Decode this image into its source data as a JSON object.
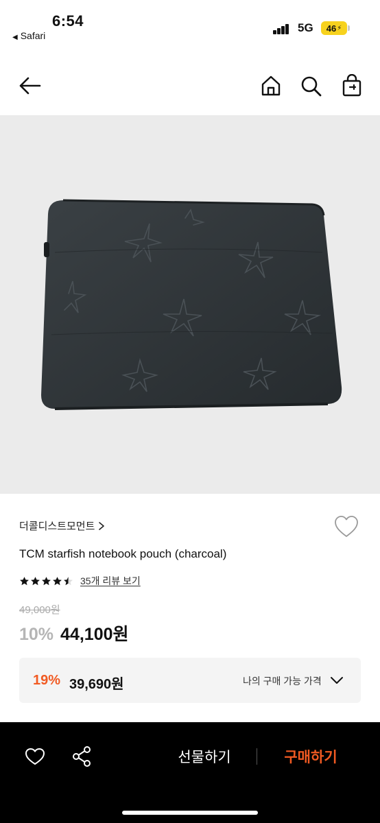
{
  "status_bar": {
    "time": "6:54",
    "back_app": "Safari",
    "network": "5G",
    "battery": "46"
  },
  "nav": {
    "back_icon": "arrow-left-icon",
    "home_icon": "home-icon",
    "search_icon": "search-icon",
    "bag_icon": "shopping-bag-icon"
  },
  "product": {
    "brand": "더콜디스트모먼트",
    "title": "TCM starfish notebook pouch (charcoal)",
    "rating": 4.5,
    "review_link": "35개 리뷰 보기",
    "original_price": "49,000원",
    "discount": "10%",
    "sale_price": "44,100원",
    "image_description_icon": "charcoal-quilted-pouch-image"
  },
  "my_price": {
    "discount": "19%",
    "price": "39,690원",
    "label": "나의 구매 가능 가격"
  },
  "bottom_bar": {
    "gift_label": "선물하기",
    "buy_label": "구매하기"
  },
  "colors": {
    "accent": "#f15a22",
    "image_bg": "#ebebeb",
    "pouch": "#2d3336"
  }
}
